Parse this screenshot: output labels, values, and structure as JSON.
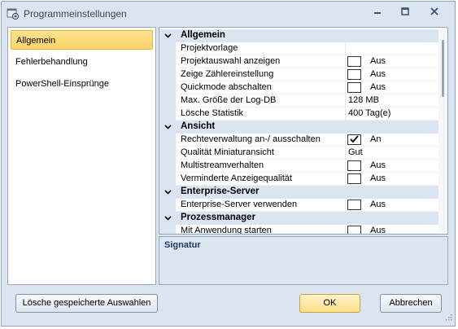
{
  "window": {
    "title": "Programmeinstellungen"
  },
  "nav": {
    "items": [
      {
        "label": "Allgemein",
        "selected": true
      },
      {
        "label": "Fehlerbehandlung"
      },
      {
        "label": "PowerShell-Einsprünge"
      }
    ]
  },
  "grid": {
    "categories": [
      {
        "label": "Allgemein",
        "properties": [
          {
            "name": "Projektvorlage",
            "value": ""
          },
          {
            "name": "Projektauswahl anzeigen",
            "checked": false,
            "value": "Aus"
          },
          {
            "name": "Zeige Zählereinstellung",
            "checked": false,
            "value": "Aus"
          },
          {
            "name": "Quickmode abschalten",
            "checked": false,
            "value": "Aus"
          },
          {
            "name": "Max. Größe der Log-DB",
            "value": "128 MB"
          },
          {
            "name": "Lösche Statistik",
            "value": "400 Tag(e)"
          }
        ]
      },
      {
        "label": "Ansicht",
        "properties": [
          {
            "name": "Rechteverwaltung an-/ ausschalten",
            "checked": true,
            "value": "An"
          },
          {
            "name": "Qualität Miniaturansicht",
            "value": "Gut"
          },
          {
            "name": "Multistreamverhalten",
            "checked": false,
            "value": "Aus"
          },
          {
            "name": "Verminderte Anzeigequalität",
            "checked": false,
            "value": "Aus"
          }
        ]
      },
      {
        "label": "Enterprise-Server",
        "properties": [
          {
            "name": "Enterprise-Server verwenden",
            "checked": false,
            "value": "Aus"
          }
        ]
      },
      {
        "label": "Prozessmanager",
        "properties": [
          {
            "name": "Mit Anwendung starten",
            "checked": false,
            "value": "Aus"
          }
        ]
      }
    ]
  },
  "description": {
    "title": "Signatur"
  },
  "buttons": {
    "clear_selections": "Lösche gespeicherte Auswahlen",
    "ok": "OK",
    "cancel": "Abbrechen"
  },
  "colors": {
    "window_bg": "#dbe5f1",
    "selection": "#fbd468",
    "accent": "#1f3a60"
  }
}
